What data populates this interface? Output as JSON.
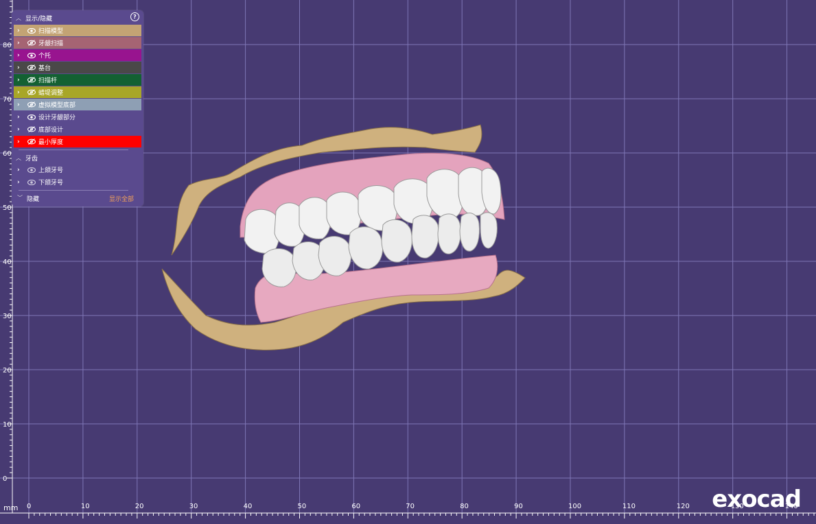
{
  "viewport": {
    "unit_label": "mm",
    "x_ticks": [
      "0",
      "10",
      "20",
      "30",
      "40",
      "50",
      "60",
      "70",
      "80",
      "90",
      "100",
      "110",
      "120",
      "130",
      "140"
    ],
    "y_ticks": [
      "80",
      "70",
      "60",
      "50",
      "40",
      "30",
      "20",
      "10",
      "0"
    ]
  },
  "panel": {
    "display_section": {
      "title": "显示/隐藏"
    },
    "items": [
      {
        "label": "扫描模型",
        "color": "#c3a374",
        "visible": true
      },
      {
        "label": "牙龈扫描",
        "color": "#a56473",
        "visible": false
      },
      {
        "label": "个托",
        "color": "#98148f",
        "visible": true
      },
      {
        "label": "基台",
        "color": "#4a4848",
        "visible": false
      },
      {
        "label": "扫描杆",
        "color": "#136132",
        "visible": false
      },
      {
        "label": "蜡堤调整",
        "color": "#a8a628",
        "visible": false
      },
      {
        "label": "虚拟模型底部",
        "color": "#8e9fb4",
        "visible": false
      },
      {
        "label": "设计牙龈部分",
        "color": "",
        "visible": true
      },
      {
        "label": "底部设计",
        "color": "",
        "visible": false
      },
      {
        "label": "最小厚度",
        "color": "#ff0000",
        "visible": false
      }
    ],
    "teeth_section": {
      "title": "牙齿"
    },
    "teeth_items": [
      {
        "label": "上颌牙号"
      },
      {
        "label": "下颌牙号"
      }
    ],
    "hidden_section": {
      "title": "隐藏",
      "show_all_label": "显示全部"
    }
  },
  "logo": {
    "text": "exocad"
  },
  "icons": {
    "help": "question-circle-icon",
    "eye_open": "eye-icon",
    "eye_closed": "eye-off-icon",
    "expand": "chevron-right-icon",
    "collapse": "chevron-up-icon"
  },
  "colors": {
    "background": "#473a72",
    "grid": "#8077b8",
    "panel": "#5a4a8e",
    "accent_show_all": "#f3a15a"
  }
}
